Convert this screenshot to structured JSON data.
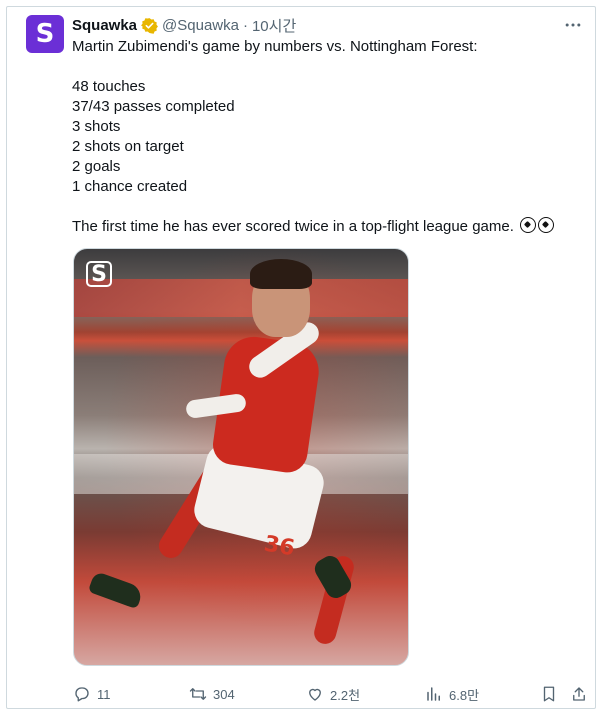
{
  "author": {
    "name": "Squawka",
    "handle": "@Squawka",
    "separator": "·",
    "time": "10시간",
    "avatar_glyph": "S",
    "avatar_color": "#6b2fd6",
    "verified_color": "#e8b600"
  },
  "tweet": {
    "intro": "Martin Zubimendi's game by numbers vs. Nottingham Forest:",
    "stats": [
      "48 touches",
      "37/43 passes completed",
      "3 shots",
      "2 shots on target",
      "2 goals",
      "1 chance created"
    ],
    "closing": "The first time he has ever scored twice in a top-flight league game.",
    "closing_emoji": [
      "soccer-ball-emoji",
      "soccer-ball-emoji"
    ]
  },
  "media": {
    "watermark_glyph": "S",
    "jersey_number": "36"
  },
  "actions": {
    "replies": "11",
    "retweets": "304",
    "likes": "2.2천",
    "views": "6.8만"
  },
  "colors": {
    "text": "#0f1419",
    "secondary": "#536471",
    "border": "#cfd9de"
  }
}
